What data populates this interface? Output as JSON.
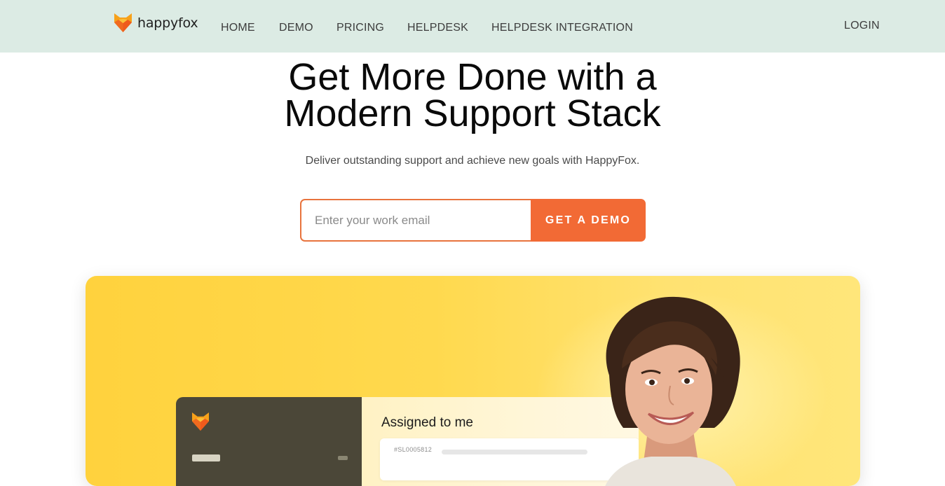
{
  "brand": {
    "name": "happyfox",
    "accent": "#f26a35",
    "nav_bg": "#dcebe4",
    "panel_color": "#ffd94e"
  },
  "nav": {
    "items": [
      {
        "label": "HOME"
      },
      {
        "label": "DEMO"
      },
      {
        "label": "PRICING"
      },
      {
        "label": "HELPDESK"
      },
      {
        "label": "HELPDESK INTEGRATION"
      }
    ],
    "login_label": "LOGIN"
  },
  "hero": {
    "title_line1": "Get More Done with a",
    "title_line2": "Modern Support Stack",
    "subtitle": "Deliver outstanding support and achieve new goals with HappyFox."
  },
  "demo_form": {
    "email_placeholder": "Enter your work email",
    "email_value": "",
    "button_label": "GET A DEMO"
  },
  "showcase": {
    "panel_title": "Assigned to me",
    "ticket_id": "#SL0005812",
    "icons": [
      "fox-logo-icon"
    ]
  }
}
